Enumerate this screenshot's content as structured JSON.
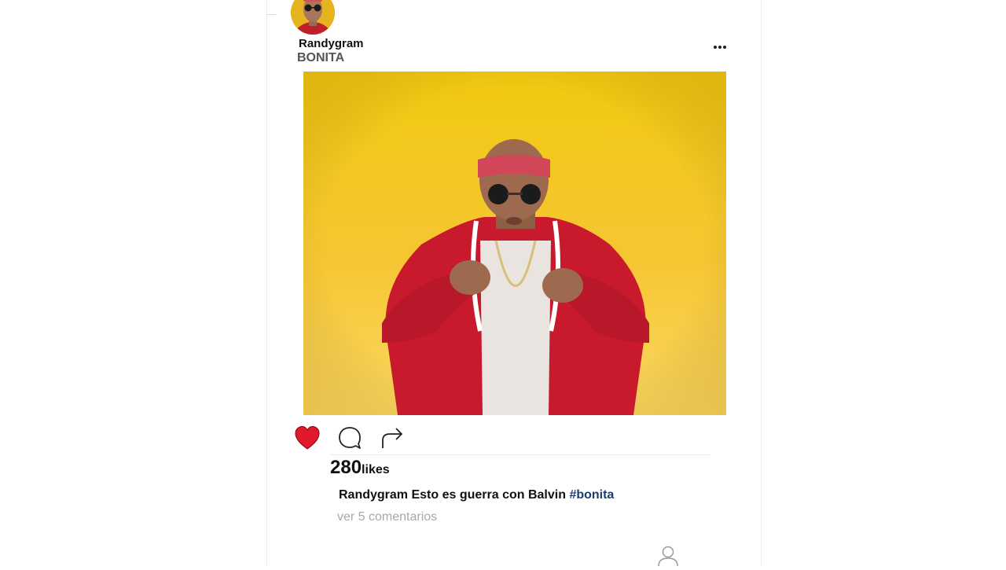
{
  "post": {
    "username": "Randygram",
    "subtitle": "BONITA",
    "likes_count": "280",
    "likes_word": "likes",
    "caption_user": "Randygram",
    "caption_text": " Esto es guerra con Balvin ",
    "caption_hashtag": "#bonita",
    "view_comments": "ver 5 comentarios",
    "liked": true
  },
  "actions": [
    {
      "name": "like",
      "icon": "heart-icon",
      "active": true
    },
    {
      "name": "comment",
      "icon": "comment-bubble-icon",
      "active": false
    },
    {
      "name": "share",
      "icon": "share-arrow-icon",
      "active": false
    }
  ],
  "colors": {
    "heart": "#e0192b",
    "hashtag": "#1b3d6e",
    "image_bg_top": "#f2cc16",
    "image_bg_bottom": "#fbd457"
  }
}
